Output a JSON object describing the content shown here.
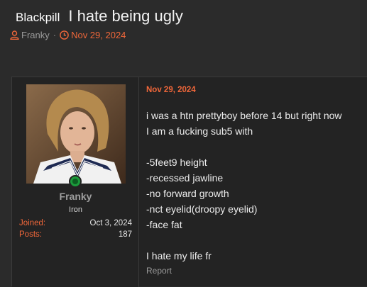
{
  "thread": {
    "prefix": "Blackpill",
    "title": "I hate being ugly",
    "author": "Franky",
    "separator": "·",
    "date": "Nov 29, 2024"
  },
  "user": {
    "name": "Franky",
    "title": "Iron",
    "stats": [
      {
        "label": "Joined:",
        "value": "Oct 3, 2024"
      },
      {
        "label": "Posts:",
        "value": "187"
      }
    ]
  },
  "post": {
    "date": "Nov 29, 2024",
    "lines": [
      "i was a htn prettyboy before 14 but right now",
      "I am a fucking sub5 with",
      "",
      "-5feet9 height",
      "-recessed jawline",
      "-no forward growth",
      "-nct eyelid(droopy eyelid)",
      "-face fat",
      "",
      "I hate my life fr"
    ],
    "report_label": "Report"
  },
  "colors": {
    "accent": "#f0673a",
    "background": "#2b2b2b",
    "panel": "#232323"
  }
}
